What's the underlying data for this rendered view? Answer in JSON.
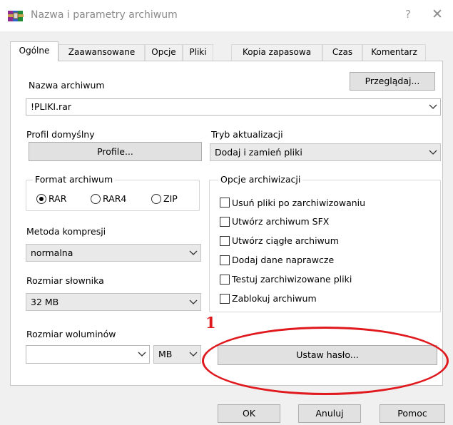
{
  "window": {
    "title": "Nazwa i parametry archiwum",
    "help_glyph": "?",
    "close_glyph": "✕"
  },
  "tabs": [
    {
      "label": "Ogólne",
      "active": true
    },
    {
      "label": "Zaawansowane",
      "active": false
    },
    {
      "label": "Opcje",
      "active": false
    },
    {
      "label": "Pliki",
      "active": false
    },
    {
      "label": "Kopia zapasowa",
      "active": false
    },
    {
      "label": "Czas",
      "active": false
    },
    {
      "label": "Komentarz",
      "active": false
    }
  ],
  "archive_name": {
    "label": "Nazwa archiwum",
    "browse_label": "Przeglądaj...",
    "value": "!PLIKI.rar"
  },
  "profile": {
    "label": "Profil domyślny",
    "button_label": "Profile..."
  },
  "update_mode": {
    "label": "Tryb aktualizacji",
    "value": "Dodaj i zamień pliki"
  },
  "archive_format": {
    "title": "Format archiwum",
    "options": [
      {
        "label": "RAR",
        "selected": true
      },
      {
        "label": "RAR4",
        "selected": false
      },
      {
        "label": "ZIP",
        "selected": false
      }
    ]
  },
  "archive_options": {
    "title": "Opcje archiwizacji",
    "items": [
      {
        "label": "Usuń pliki po zarchiwizowaniu",
        "checked": false
      },
      {
        "label": "Utwórz archiwum SFX",
        "checked": false
      },
      {
        "label": "Utwórz ciągłe archiwum",
        "checked": false
      },
      {
        "label": "Dodaj dane naprawcze",
        "checked": false
      },
      {
        "label": "Testuj zarchiwizowane pliki",
        "checked": false
      },
      {
        "label": "Zablokuj archiwum",
        "checked": false
      }
    ]
  },
  "compression": {
    "label": "Metoda kompresji",
    "value": "normalna"
  },
  "dictionary": {
    "label": "Rozmiar słownika",
    "value": "32 MB"
  },
  "volumes": {
    "label": "Rozmiar woluminów",
    "size_value": "",
    "unit_value": "MB"
  },
  "password_button_label": "Ustaw hasło...",
  "annotation": {
    "number": "1",
    "color": "#e0191f"
  },
  "footer": {
    "ok_label": "OK",
    "cancel_label": "Anuluj",
    "help_label": "Pomoc"
  }
}
